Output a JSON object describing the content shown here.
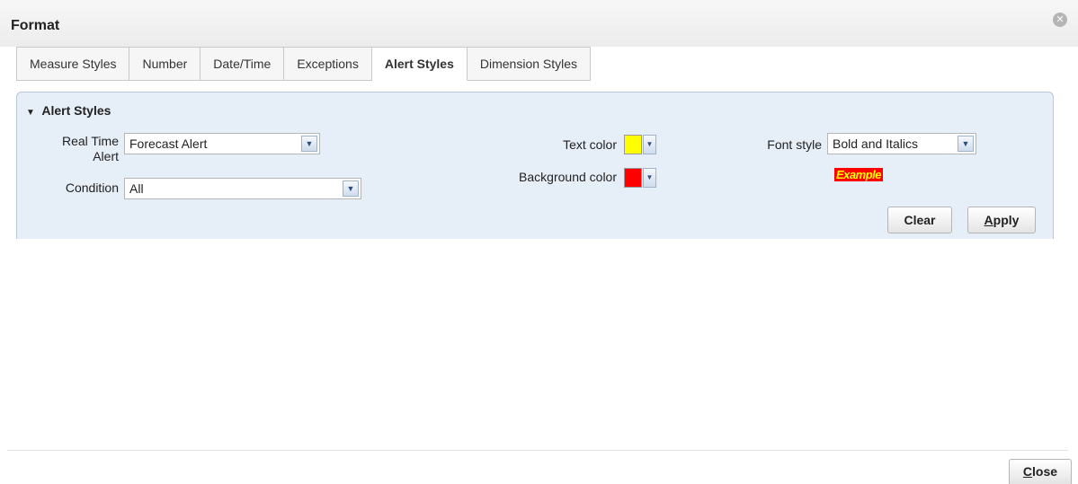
{
  "dialog": {
    "title": "Format",
    "close_glyph": "✕"
  },
  "tabs": [
    {
      "label": "Measure Styles"
    },
    {
      "label": "Number"
    },
    {
      "label": "Date/Time"
    },
    {
      "label": "Exceptions"
    },
    {
      "label": "Alert Styles",
      "active": true
    },
    {
      "label": "Dimension Styles"
    }
  ],
  "panel": {
    "header": "Alert Styles",
    "expanded": true,
    "real_time_alert": {
      "label_line1": "Real Time",
      "label_line2": "Alert",
      "value": "Forecast Alert"
    },
    "condition": {
      "label": "Condition",
      "value": "All"
    },
    "text_color": {
      "label": "Text color",
      "color": "#ffff00"
    },
    "background_color": {
      "label": "Background color",
      "color": "#ff0000"
    },
    "font_style": {
      "label": "Font style",
      "value": "Bold and Italics"
    },
    "example": {
      "text": "Example",
      "text_color": "#ffff00",
      "background": "#ff0000"
    },
    "buttons": {
      "clear": "Clear",
      "apply_accel": "A",
      "apply_rest": "pply"
    }
  },
  "footer": {
    "close_accel": "C",
    "close_rest": "lose"
  },
  "colors": {
    "panel_bg": "#e6eef8",
    "panel_border": "#b8c8dc",
    "arrow_blue": "#2c4f7c"
  }
}
